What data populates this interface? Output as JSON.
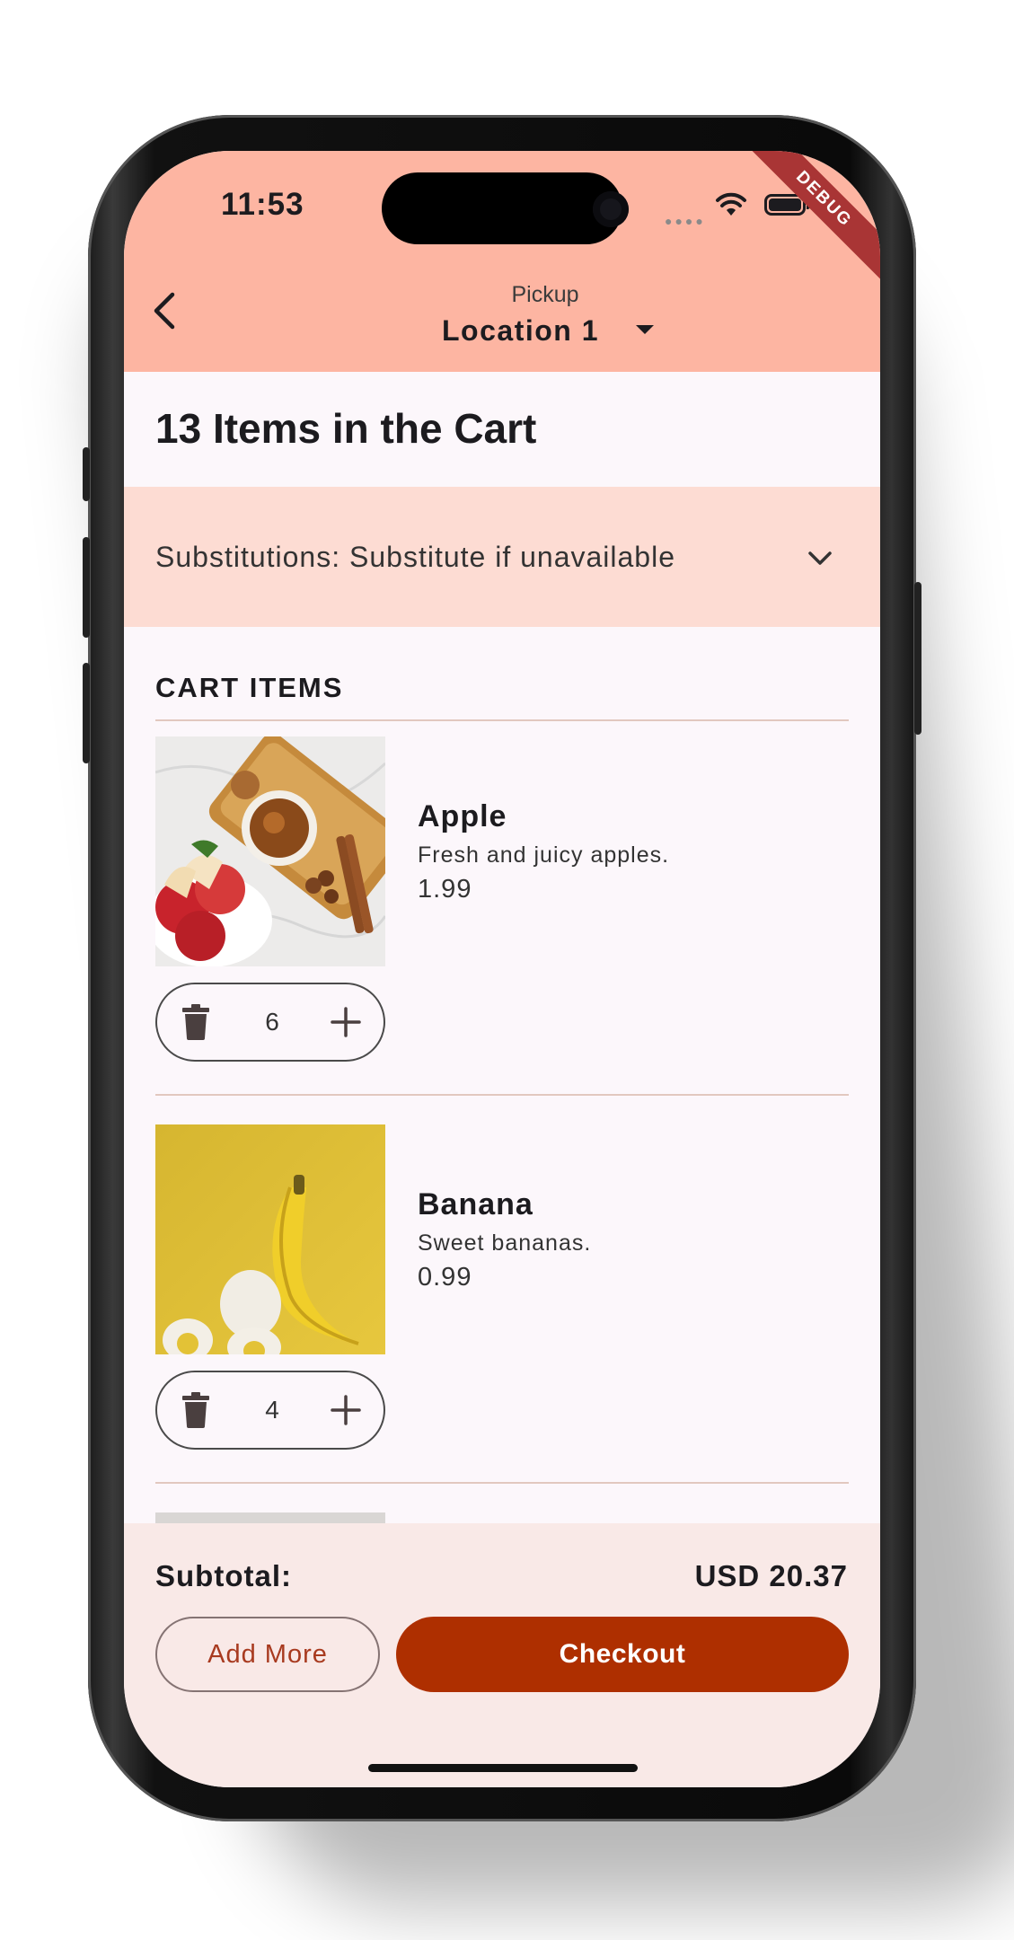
{
  "status_bar": {
    "time": "11:53",
    "debug_banner": "DEBUG"
  },
  "header": {
    "pickup_label": "Pickup",
    "location": "Location 1"
  },
  "cart": {
    "title": "13 Items in the Cart",
    "substitutions": "Substitutions: Substitute if unavailable",
    "section_title": "CART ITEMS",
    "items": [
      {
        "name": "Apple",
        "description": "Fresh and juicy apples.",
        "price": "1.99",
        "quantity": "6"
      },
      {
        "name": "Banana",
        "description": "Sweet bananas.",
        "price": "0.99",
        "quantity": "4"
      }
    ]
  },
  "footer": {
    "subtotal_label": "Subtotal:",
    "subtotal_value": "USD 20.37",
    "add_more_label": "Add More",
    "checkout_label": "Checkout"
  },
  "colors": {
    "appbar": "#fdb5a2",
    "substitutions_bg": "#fddcd3",
    "checkout": "#ae2f00",
    "add_more_text": "#a83a1f"
  },
  "icons": [
    "back-arrow-icon",
    "dropdown-caret-icon",
    "chevron-down-icon",
    "trash-icon",
    "plus-icon",
    "wifi-icon",
    "battery-icon"
  ]
}
